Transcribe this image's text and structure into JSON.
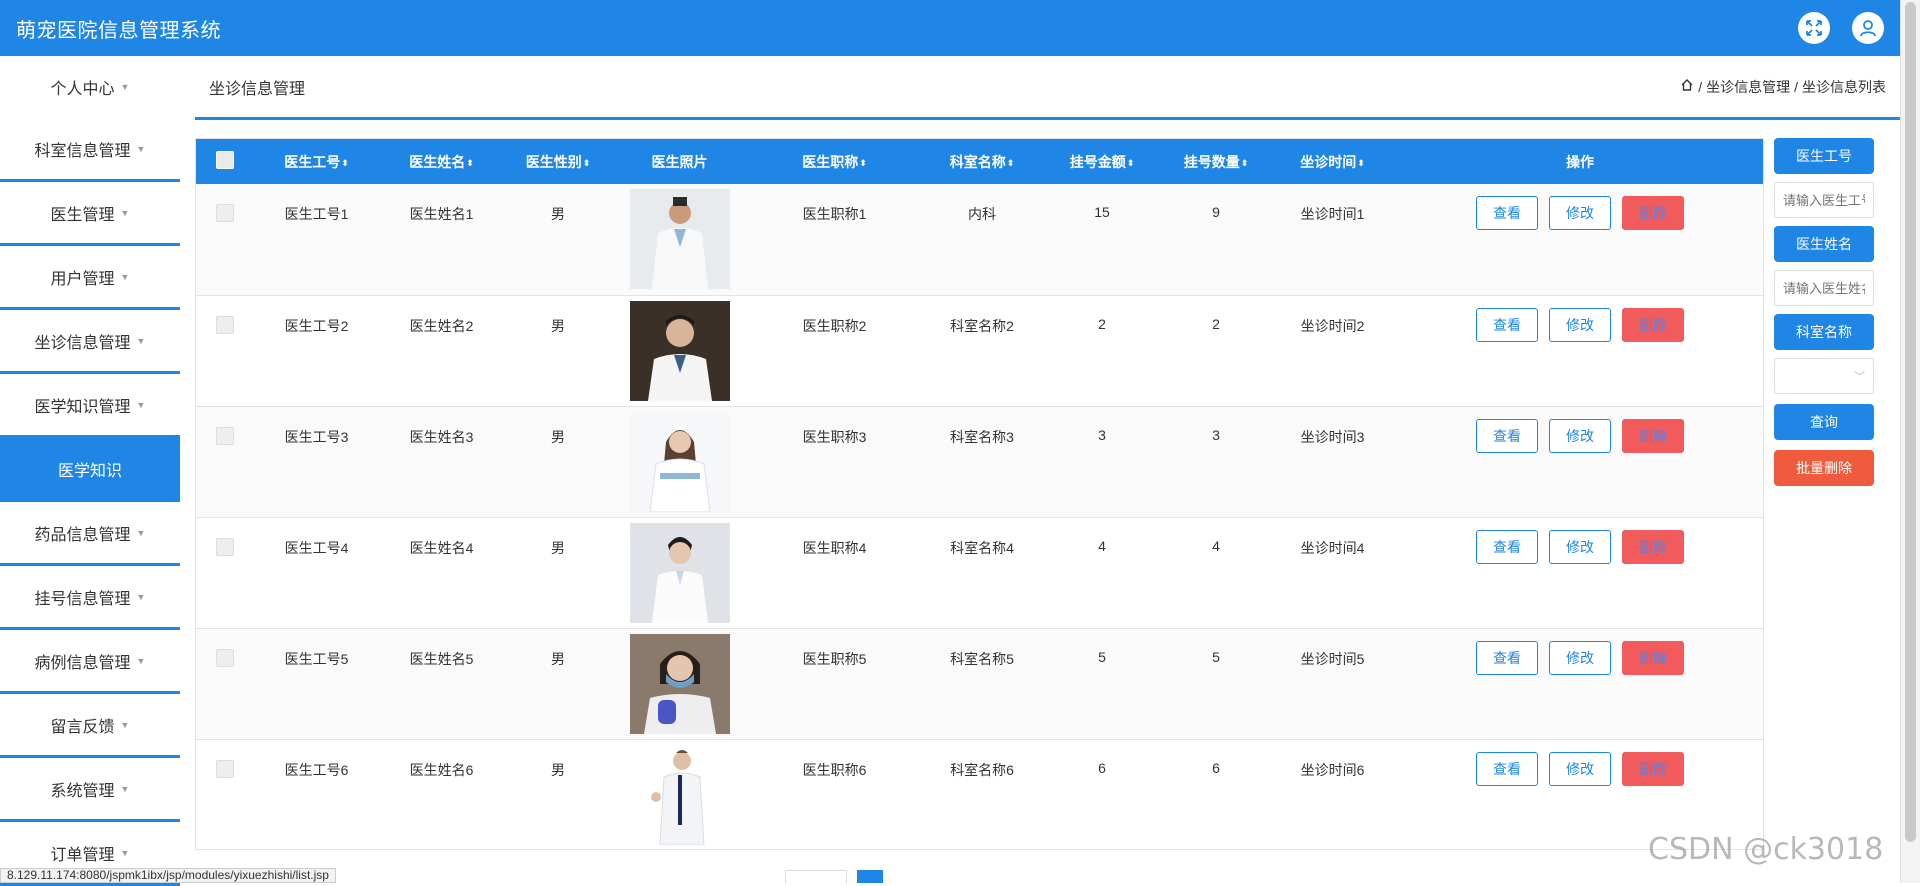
{
  "header": {
    "title": "萌宠医院信息管理系统",
    "icons": [
      "fullscreen-icon",
      "user-icon"
    ]
  },
  "sidebar": {
    "items": [
      {
        "label": "个人中心"
      },
      {
        "label": "科室信息管理"
      },
      {
        "label": "医生管理"
      },
      {
        "label": "用户管理"
      },
      {
        "label": "坐诊信息管理"
      },
      {
        "label": "医学知识管理"
      },
      {
        "label": "医学知识",
        "active": true
      },
      {
        "label": "药品信息管理"
      },
      {
        "label": "挂号信息管理"
      },
      {
        "label": "病例信息管理"
      },
      {
        "label": "留言反馈"
      },
      {
        "label": "系统管理"
      },
      {
        "label": "订单管理"
      }
    ]
  },
  "crumbbar": {
    "page_title": "坐诊信息管理",
    "crumb_1": "坐诊信息管理",
    "crumb_2": "坐诊信息列表"
  },
  "table": {
    "headers": [
      "医生工号",
      "医生姓名",
      "医生性别",
      "医生照片",
      "医生职称",
      "科室名称",
      "挂号金额",
      "挂号数量",
      "坐诊时间",
      "操作"
    ],
    "rows": [
      {
        "id": "医生工号1",
        "name": "医生姓名1",
        "gender": "男",
        "title": "医生职称1",
        "dept": "内科",
        "fee": "15",
        "count": "9",
        "time": "坐诊时间1"
      },
      {
        "id": "医生工号2",
        "name": "医生姓名2",
        "gender": "男",
        "title": "医生职称2",
        "dept": "科室名称2",
        "fee": "2",
        "count": "2",
        "time": "坐诊时间2"
      },
      {
        "id": "医生工号3",
        "name": "医生姓名3",
        "gender": "男",
        "title": "医生职称3",
        "dept": "科室名称3",
        "fee": "3",
        "count": "3",
        "time": "坐诊时间3"
      },
      {
        "id": "医生工号4",
        "name": "医生姓名4",
        "gender": "男",
        "title": "医生职称4",
        "dept": "科室名称4",
        "fee": "4",
        "count": "4",
        "time": "坐诊时间4"
      },
      {
        "id": "医生工号5",
        "name": "医生姓名5",
        "gender": "男",
        "title": "医生职称5",
        "dept": "科室名称5",
        "fee": "5",
        "count": "5",
        "time": "坐诊时间5"
      },
      {
        "id": "医生工号6",
        "name": "医生姓名6",
        "gender": "男",
        "title": "医生职称6",
        "dept": "科室名称6",
        "fee": "6",
        "count": "6",
        "time": "坐诊时间6"
      }
    ],
    "actions": {
      "view": "查看",
      "edit": "修改",
      "delete": "删除"
    }
  },
  "search": {
    "label_id": "医生工号",
    "placeholder_id": "请输入医生工号",
    "label_name": "医生姓名",
    "placeholder_name": "请输入医生姓名",
    "label_dept": "科室名称",
    "query": "查询",
    "batch_delete": "批量删除"
  },
  "status": {
    "url": "8.129.11.174:8080/jspmk1ibx/jsp/modules/yixuezhishi/list.jsp"
  },
  "watermark": "CSDN @ck3018",
  "colors": {
    "primary": "#1f86e6",
    "danger": "#f15b5b",
    "batch": "#f15b3d"
  }
}
